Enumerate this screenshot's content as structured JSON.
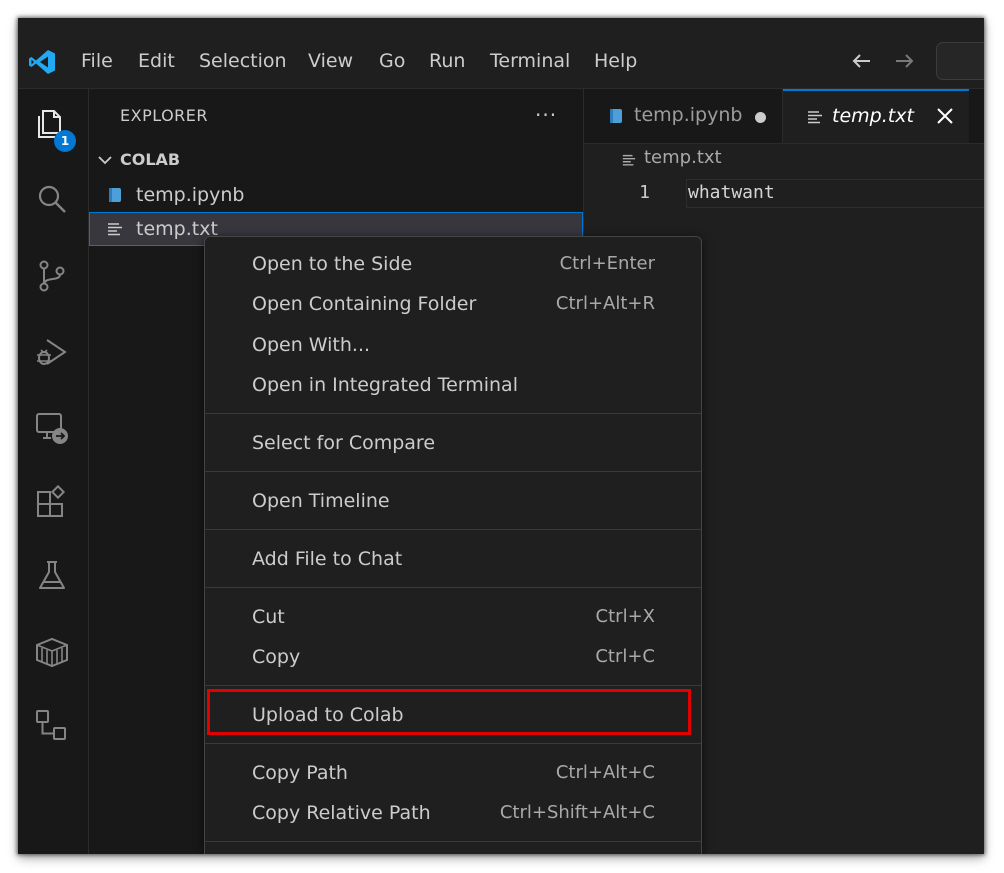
{
  "titlebar": {
    "logo_icon": "vscode-logo-icon",
    "menu": [
      "File",
      "Edit",
      "Selection",
      "View",
      "Go",
      "Run",
      "Terminal",
      "Help"
    ],
    "back_icon": "arrow-left-icon",
    "forward_icon": "arrow-right-icon"
  },
  "activitybar": {
    "items": [
      "explorer-icon",
      "search-icon",
      "source-control-icon",
      "run-debug-icon",
      "remote-explorer-icon",
      "extensions-icon",
      "testing-icon",
      "containers-icon",
      "workflow-icon"
    ],
    "explorer_badge": "1",
    "accent_color": "#0078d4"
  },
  "sidebar": {
    "title": "EXPLORER",
    "more_label": "···",
    "folder": "COLAB",
    "files": [
      {
        "name": "temp.ipynb",
        "icon": "notebook-icon"
      },
      {
        "name": "temp.txt",
        "icon": "text-file-icon",
        "selected": true
      }
    ]
  },
  "editor": {
    "tabs": [
      {
        "label": "temp.ipynb",
        "icon": "notebook-icon",
        "dirty": true,
        "active": false
      },
      {
        "label": "temp.txt",
        "icon": "text-file-icon",
        "active": true,
        "italic": true
      }
    ],
    "close_icon": "close-icon",
    "breadcrumb": "temp.txt",
    "lines": [
      {
        "number": "1",
        "text": "whatwant"
      }
    ]
  },
  "context_menu": {
    "groups": [
      [
        {
          "label": "Open to the Side",
          "shortcut": "Ctrl+Enter"
        },
        {
          "label": "Open Containing Folder",
          "shortcut": "Ctrl+Alt+R"
        },
        {
          "label": "Open With...",
          "shortcut": ""
        },
        {
          "label": "Open in Integrated Terminal",
          "shortcut": ""
        }
      ],
      [
        {
          "label": "Select for Compare",
          "shortcut": ""
        }
      ],
      [
        {
          "label": "Open Timeline",
          "shortcut": ""
        }
      ],
      [
        {
          "label": "Add File to Chat",
          "shortcut": ""
        }
      ],
      [
        {
          "label": "Cut",
          "shortcut": "Ctrl+X"
        },
        {
          "label": "Copy",
          "shortcut": "Ctrl+C"
        }
      ],
      [
        {
          "label": "Upload to Colab",
          "shortcut": "",
          "highlighted": true
        }
      ],
      [
        {
          "label": "Copy Path",
          "shortcut": "Ctrl+Alt+C"
        },
        {
          "label": "Copy Relative Path",
          "shortcut": "Ctrl+Shift+Alt+C"
        }
      ]
    ],
    "highlight_color": "#e30000"
  }
}
